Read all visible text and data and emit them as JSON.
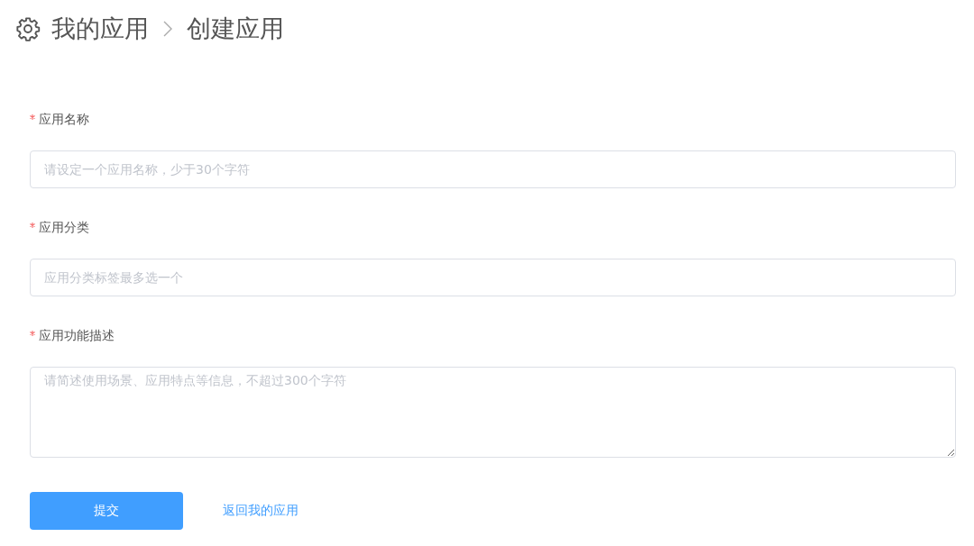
{
  "breadcrumb": [
    {
      "label": "我的应用"
    },
    {
      "label": "创建应用"
    }
  ],
  "fields": [
    {
      "kind": "input",
      "label": "应用名称",
      "required": true,
      "placeholder": "请设定一个应用名称，少于30个字符"
    },
    {
      "kind": "input",
      "label": "应用分类",
      "required": true,
      "placeholder": "应用分类标签最多选一个"
    },
    {
      "kind": "textarea",
      "label": "应用功能描述",
      "required": true,
      "placeholder": "请简述使用场景、应用特点等信息，不超过300个字符"
    }
  ],
  "actions": {
    "submit": "提交",
    "back_link": "返回我的应用"
  }
}
